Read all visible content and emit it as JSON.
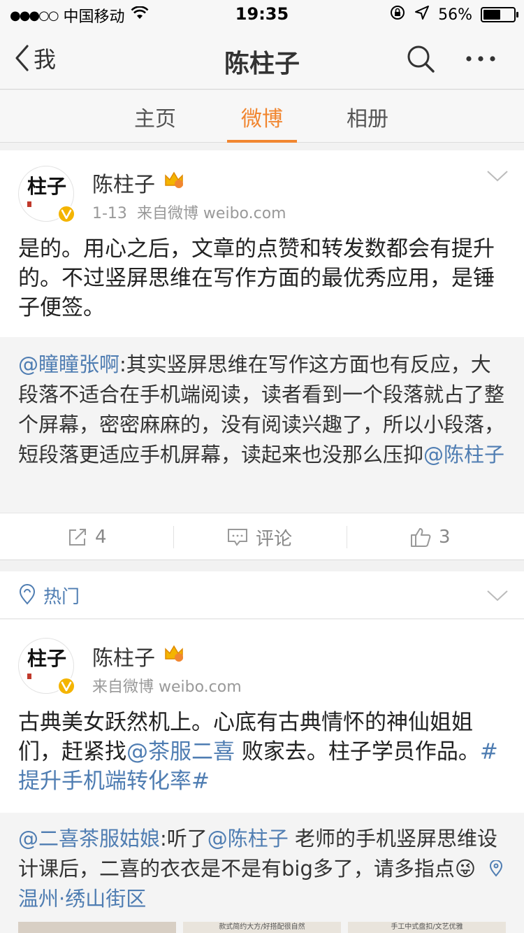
{
  "status_bar": {
    "signal": "●●●○○",
    "carrier": "中国移动",
    "time": "19:35",
    "battery": "56%",
    "battery_level": 0.56
  },
  "nav": {
    "back_label": "我",
    "title": "陈柱子"
  },
  "tabs": [
    {
      "label": "主页"
    },
    {
      "label": "微博"
    },
    {
      "label": "相册"
    }
  ],
  "avatar_text": "柱子",
  "post1": {
    "author": "陈柱子",
    "date": "1-13",
    "source": "来自微博 weibo.com",
    "text": "是的。用心之后，文章的点赞和转发数都会有提升的。不过竖屏思维在写作方面的最优秀应用，是锤子便签。",
    "repost": {
      "mention": "@瞳瞳张啊",
      "text": ":其实竖屏思维在写作这方面也有反应，大段落不适合在手机端阅读，读者看到一个段落就占了整个屏幕，密密麻麻的，没有阅读兴趣了，所以小段落，短段落更适应手机屏幕，读起来也没那么压抑",
      "mention_end": "@陈柱子"
    },
    "actions": {
      "share_count": "4",
      "comment_label": "评论",
      "like_count": "3"
    }
  },
  "hot": {
    "label": "热门"
  },
  "post2": {
    "author": "陈柱子",
    "source": "来自微博 weibo.com",
    "text_a": "古典美女跃然机上。心底有古典情怀的神仙姐姐们，赶紧找",
    "mention": "@茶服二喜",
    "text_b": " 败家去。柱子学员作品。",
    "hashtag": "#提升手机端转化率#",
    "repost": {
      "mention": "@二喜茶服姑娘",
      "text_a": ":听了",
      "mention2": "@陈柱子",
      "text_b": " 老师的手机竖屏思维设计课后，二喜的衣衣是不是有big多了，请多指点",
      "emoji": "😜",
      "location": "温州·绣山街区"
    },
    "thumbs": [
      {
        "caption": ""
      },
      {
        "caption": "款式简约大方/好搭配很自然"
      },
      {
        "caption": "手工中式盘扣/文艺优雅"
      }
    ]
  },
  "colors": {
    "accent": "#f18630",
    "link": "#4f7db2",
    "verified": "#f4b400"
  }
}
